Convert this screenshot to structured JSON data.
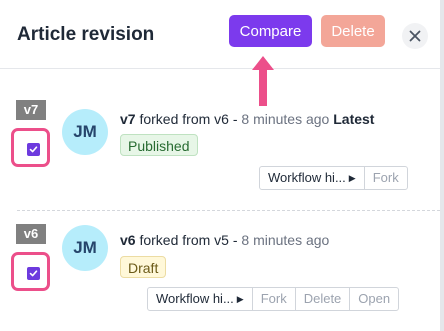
{
  "header": {
    "title": "Article revision",
    "compare_label": "Compare",
    "delete_label": "Delete",
    "close_icon": "close-icon"
  },
  "colors": {
    "accent": "#7c3aed",
    "delete_disabled": "#f3a698",
    "highlight": "#ec4f8a"
  },
  "revisions": [
    {
      "version": "v7",
      "checked": true,
      "avatar": "JM",
      "title": "v7",
      "forked_text": "forked from v6 -",
      "time": "8 minutes ago",
      "latest_label": "Latest",
      "status": "Published",
      "actions": [
        "Workflow hi...",
        "Fork"
      ]
    },
    {
      "version": "v6",
      "checked": true,
      "avatar": "JM",
      "title": "v6",
      "forked_text": "forked from v5 -",
      "time": "8 minutes ago",
      "status": "Draft",
      "actions": [
        "Workflow hi...",
        "Fork",
        "Delete",
        "Open"
      ]
    }
  ]
}
